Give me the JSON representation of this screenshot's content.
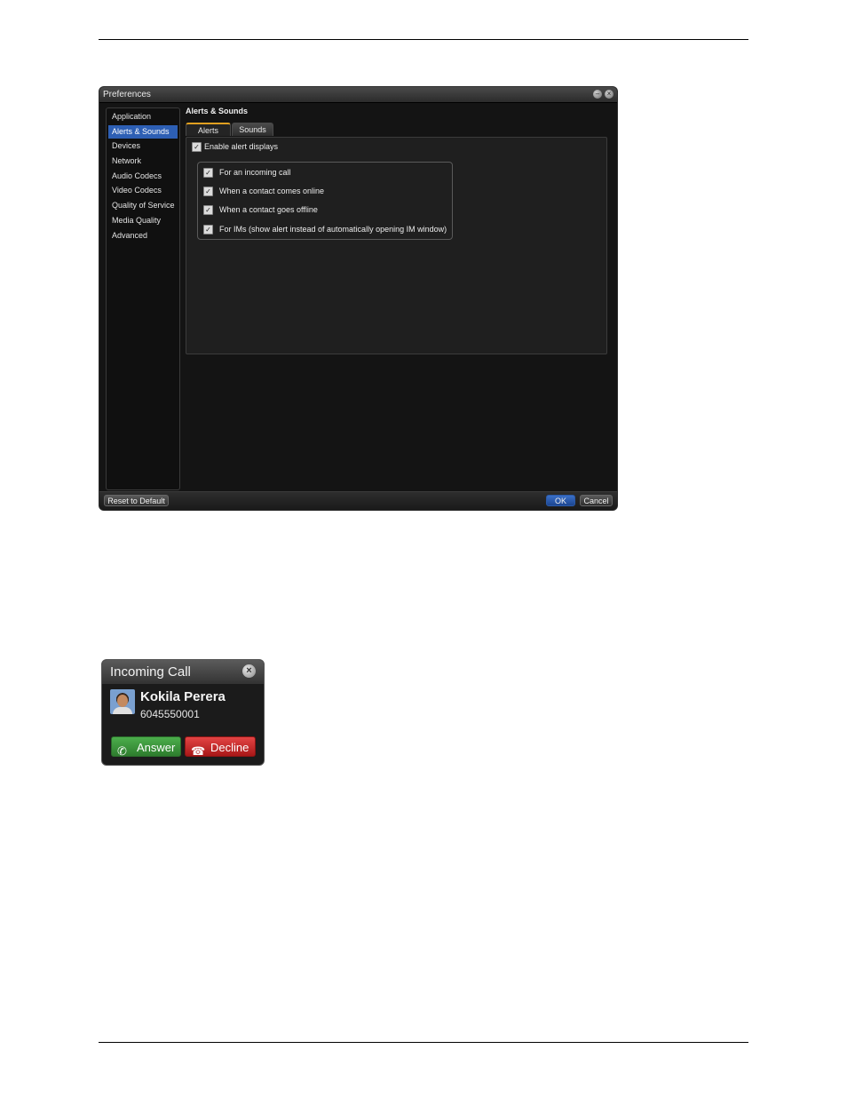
{
  "preferences": {
    "window_title": "Preferences",
    "nav_items": [
      "Application",
      "Alerts & Sounds",
      "Devices",
      "Network",
      "Audio Codecs",
      "Video Codecs",
      "Quality of Service",
      "Media Quality",
      "Advanced"
    ],
    "selected_nav": "Alerts & Sounds",
    "section_title": "Alerts & Sounds",
    "tabs": [
      "Alerts",
      "Sounds"
    ],
    "active_tab": "Alerts",
    "enable_alerts": {
      "label": "Enable alert displays",
      "checked": true
    },
    "alert_options": [
      {
        "label": "For an incoming call",
        "checked": true
      },
      {
        "label": "When a contact comes online",
        "checked": true
      },
      {
        "label": "When a contact goes offline",
        "checked": true
      },
      {
        "label": "For IMs (show alert instead of automatically opening IM window)",
        "checked": true
      }
    ],
    "buttons": {
      "reset": "Reset to Default",
      "ok": "OK",
      "cancel": "Cancel"
    }
  },
  "incoming_call": {
    "title": "Incoming Call",
    "caller_name": "Kokila Perera",
    "caller_number": "6045550001",
    "answer_label": "Answer",
    "decline_label": "Decline"
  },
  "colors": {
    "accent": "#2d5fb4",
    "answer": "#3c9a3c",
    "decline": "#d02a2a",
    "tab_highlight": "#e0a020"
  }
}
